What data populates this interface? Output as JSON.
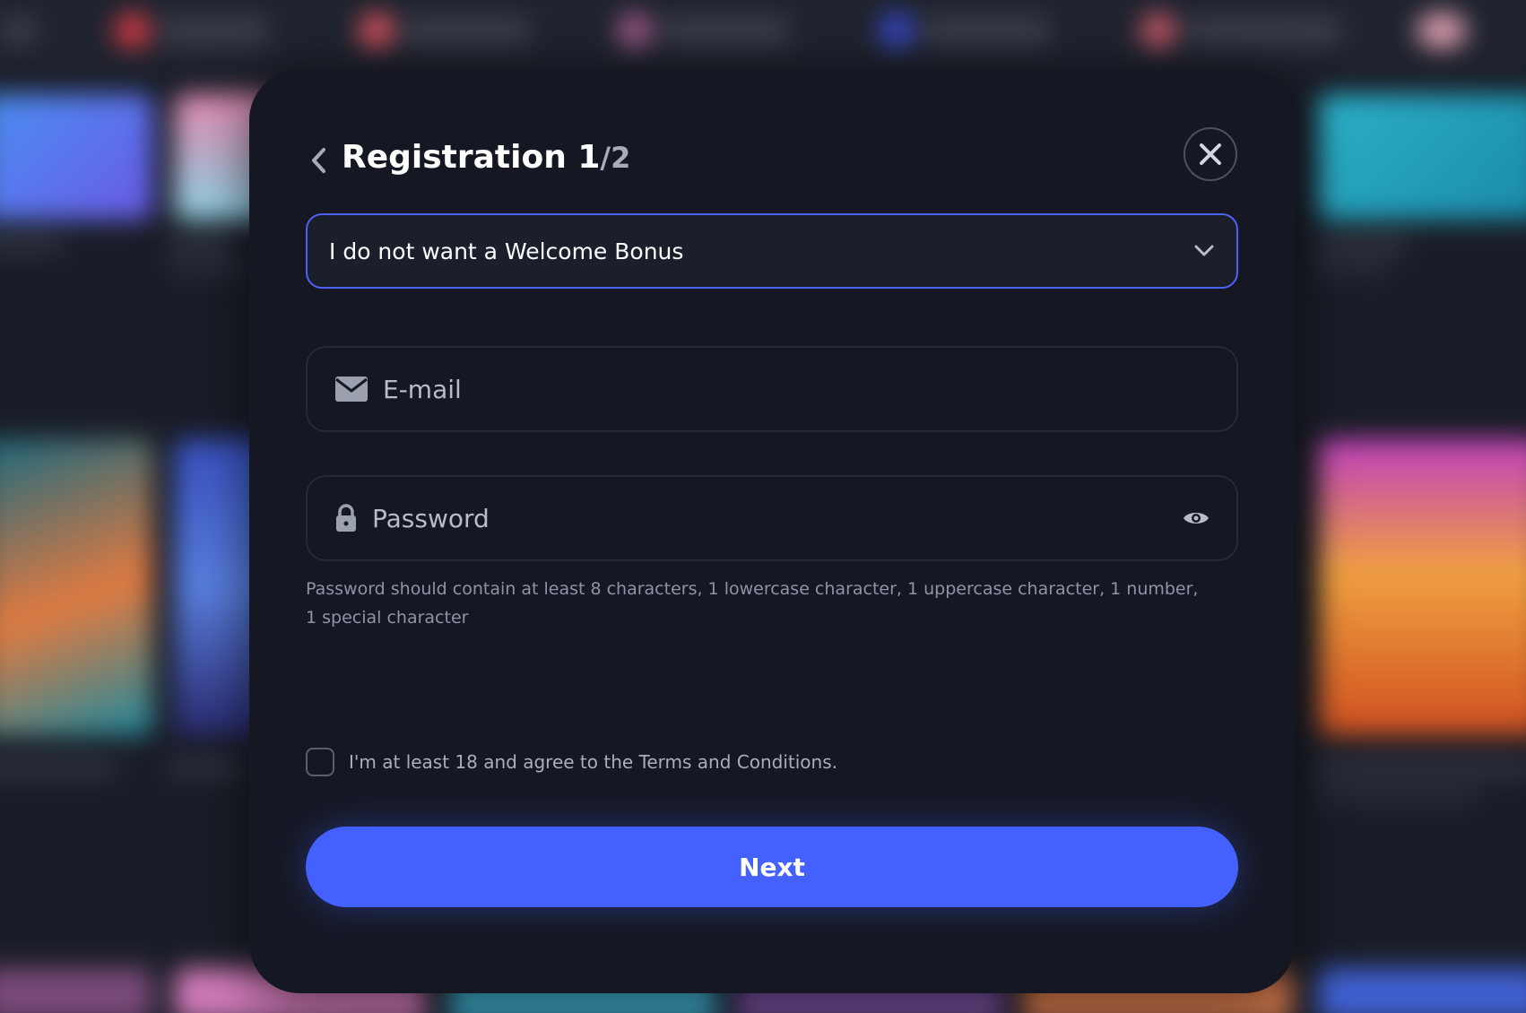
{
  "modal": {
    "title": "Registration 1",
    "step": "/2",
    "bonus_select": {
      "value": "I do not want a Welcome Bonus"
    },
    "email": {
      "placeholder": "E-mail",
      "icon": "envelope-icon"
    },
    "password": {
      "placeholder": "Password",
      "icon": "lock-icon",
      "toggle_icon": "eye-icon",
      "hint": "Password should contain at least 8 characters, 1 lowercase character, 1 uppercase character, 1 number, 1 special character"
    },
    "terms_label": "I'm at least 18 and agree to the Terms and Conditions.",
    "next_label": "Next"
  },
  "colors": {
    "modal_bg": "#151823",
    "accent": "#4461ff",
    "select_border": "#4c63f6",
    "text_primary": "#ffffff",
    "text_muted": "#8e94a5"
  }
}
